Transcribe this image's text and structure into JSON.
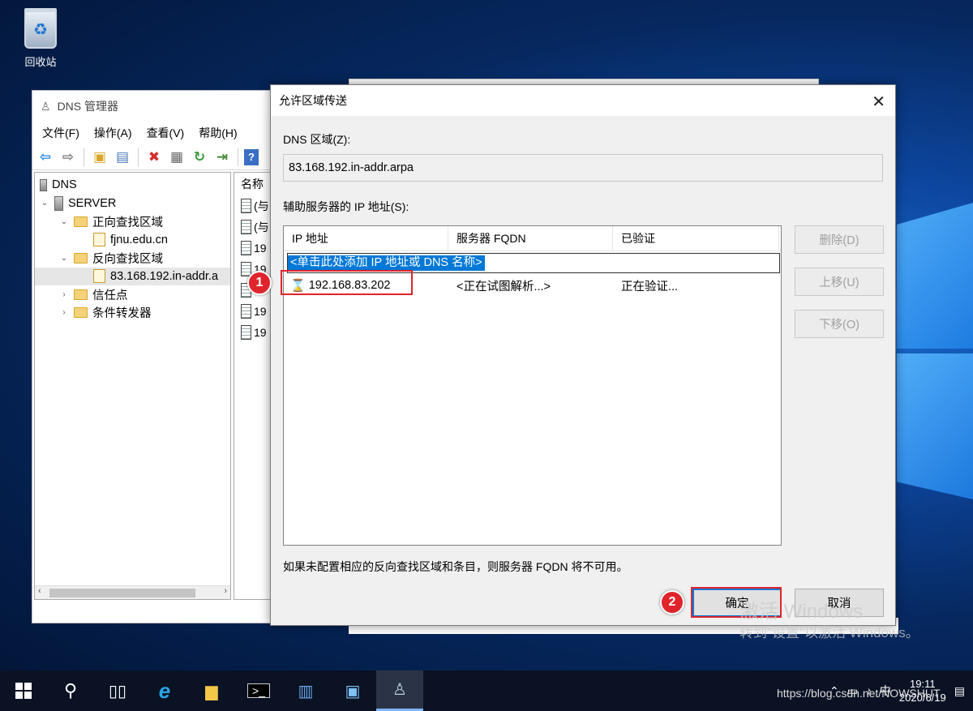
{
  "desktop": {
    "recycle_bin_label": "回收站"
  },
  "dns_manager": {
    "title": "DNS 管理器",
    "menu": [
      "文件(F)",
      "操作(A)",
      "查看(V)",
      "帮助(H)"
    ],
    "tree": [
      {
        "label": "DNS",
        "icon": "dns-icon"
      },
      {
        "label": "SERVER",
        "icon": "server-icon"
      },
      {
        "label": "正向查找区域",
        "icon": "folder-icon"
      },
      {
        "label": "fjnu.edu.cn",
        "icon": "zone-icon"
      },
      {
        "label": "反向查找区域",
        "icon": "folder-icon"
      },
      {
        "label": "83.168.192.in-addr.a",
        "icon": "zone-icon"
      },
      {
        "label": "信任点",
        "icon": "folder-icon"
      },
      {
        "label": "条件转发器",
        "icon": "folder-icon"
      }
    ],
    "right_header": "名称",
    "right_items": [
      "(与",
      "(与",
      "19",
      "19",
      "19",
      "19",
      "19"
    ]
  },
  "dialog": {
    "title": "允许区域传送",
    "zone_label": "DNS 区域(Z):",
    "zone_value": "83.168.192.in-addr.arpa",
    "servers_label": "辅助服务器的 IP 地址(S):",
    "columns": [
      "IP 地址",
      "服务器 FQDN",
      "已验证"
    ],
    "add_placeholder": "<单击此处添加 IP 地址或 DNS 名称>",
    "rows": [
      {
        "ip": "192.168.83.202",
        "fqdn": "<正在试图解析...>",
        "verified": "正在验证..."
      }
    ],
    "buttons": {
      "delete": "删除(D)",
      "up": "上移(U)",
      "down": "下移(O)",
      "ok": "确定",
      "cancel": "取消"
    },
    "note": "如果未配置相应的反向查找区域和条目，则服务器 FQDN 将不可用。"
  },
  "annotations": {
    "badge1": "1",
    "badge2": "2"
  },
  "watermark": {
    "line1": "激活 Windows",
    "line2": "转到\"设置\"以激活 Windows。"
  },
  "taskbar": {
    "time": "19:11",
    "date": "2020/6/19",
    "ime": "中",
    "csdn": "https://blog.csdn.net/NOWSHUT"
  },
  "colors": {
    "accent": "#0078d7",
    "annotation_red": "#e0242b"
  }
}
